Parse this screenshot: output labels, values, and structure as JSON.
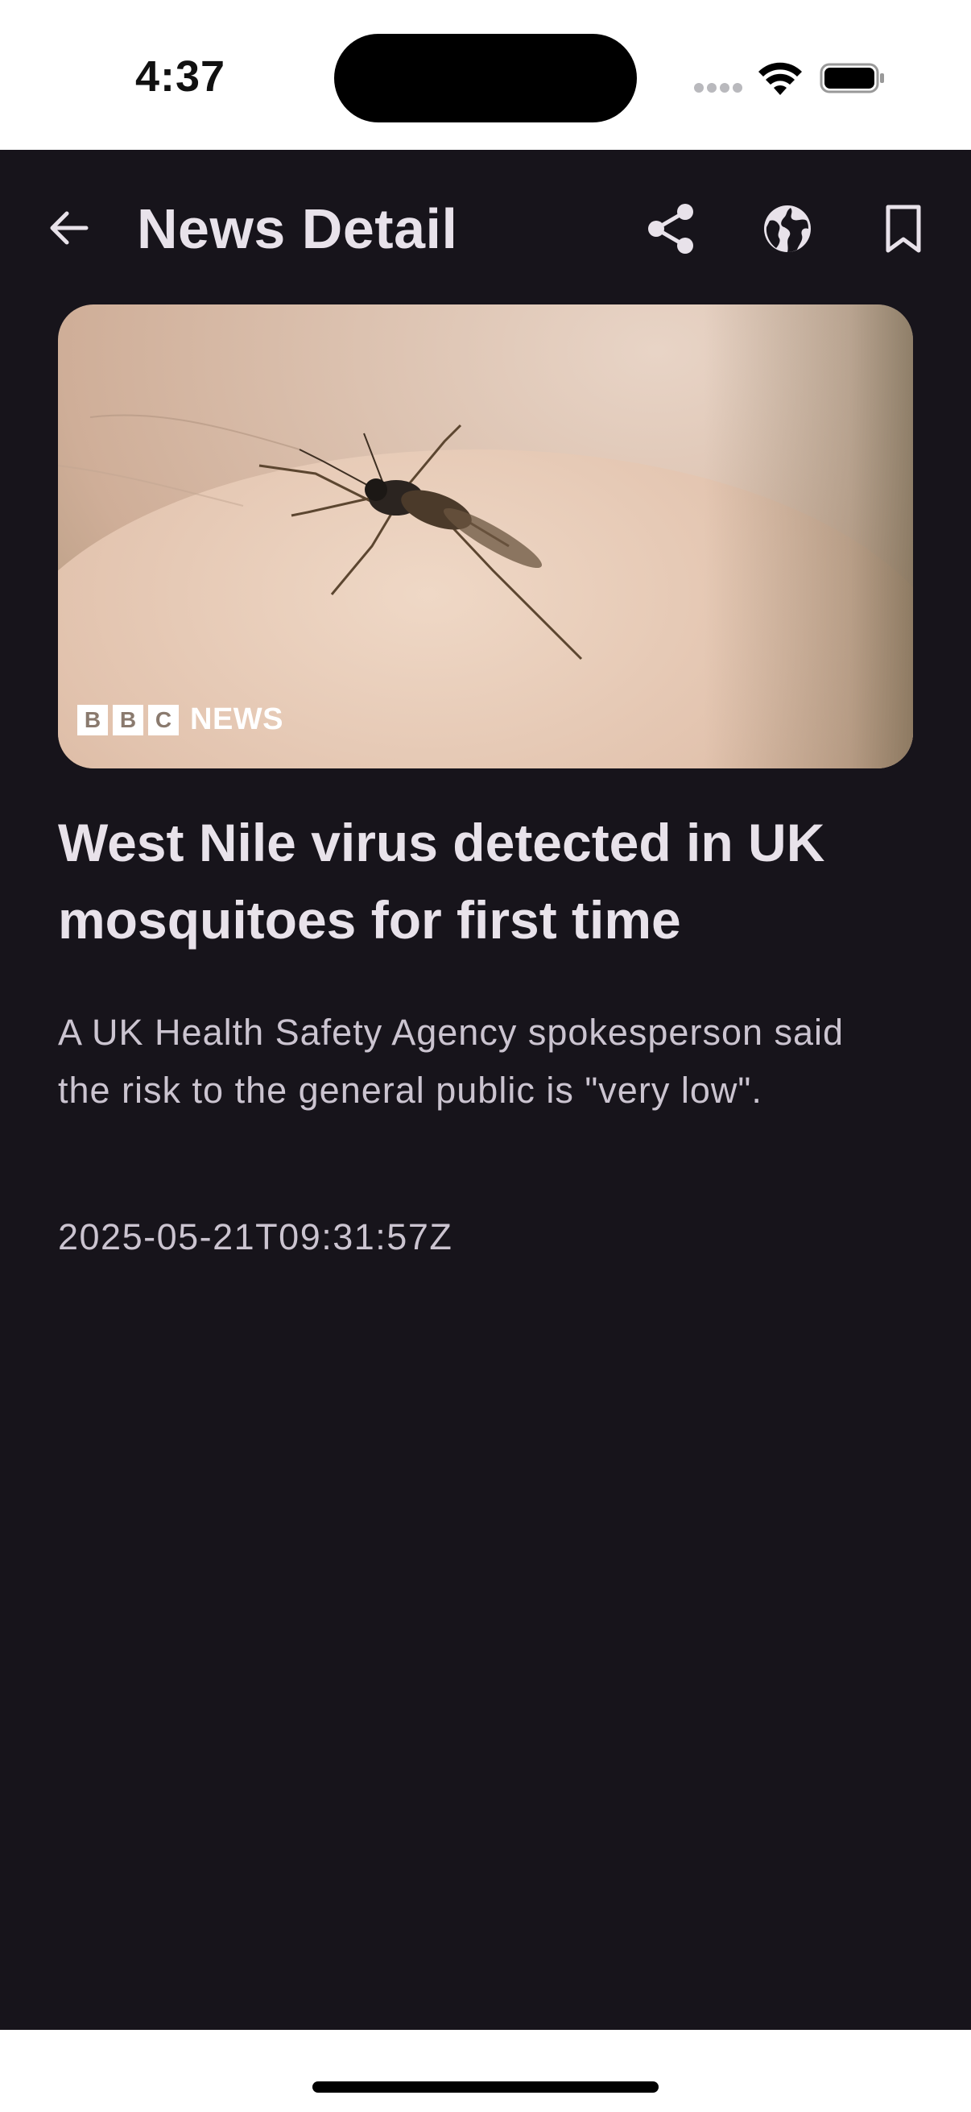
{
  "status_bar": {
    "time": "4:37"
  },
  "top_bar": {
    "title": "News Detail",
    "back_icon": "arrow-left-icon",
    "share_icon": "share-icon",
    "web_icon": "globe-icon",
    "bookmark_icon": "bookmark-icon"
  },
  "article": {
    "image_logo_text": "NEWS",
    "image_logo_letters": [
      "B",
      "B",
      "C"
    ],
    "headline": "West Nile virus detected in UK mosquitoes for first time",
    "summary": "A UK Health Safety Agency spokesperson said the risk to the general public is \"very low\".",
    "published_at": "2025-05-21T09:31:57Z"
  },
  "colors": {
    "background": "#17141b",
    "title_text": "#e8e2ea",
    "body_text": "#cbc4d0"
  }
}
